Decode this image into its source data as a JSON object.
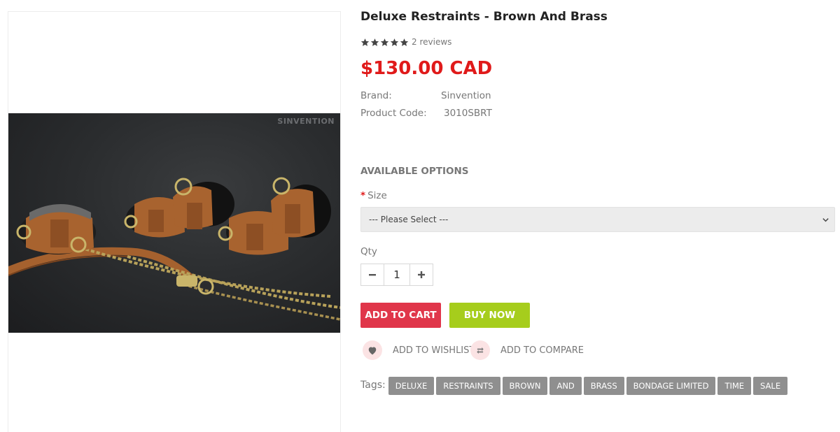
{
  "product": {
    "image_watermark": "SINVENTION",
    "title": "Deluxe Restraints - Brown And Brass",
    "rating_stars": 5,
    "reviews_text": "2 reviews",
    "price": "$130.00 CAD",
    "brand_label": "Brand:",
    "brand_value": "Sinvention",
    "code_label": "Product Code:",
    "code_value": "3010SBRT"
  },
  "options": {
    "title": "AVAILABLE OPTIONS",
    "required_mark": "*",
    "size_label": "Size",
    "size_selected": "--- Please Select ---"
  },
  "quantity": {
    "label": "Qty",
    "value": "1",
    "minus_icon": "minus-icon",
    "plus_icon": "plus-icon"
  },
  "buttons": {
    "add_to_cart": "ADD TO CART",
    "buy_now": "BUY NOW",
    "add_to_cart_color": "#e0364a",
    "buy_now_color": "#a6cd1c"
  },
  "actions": {
    "wishlist": "ADD TO WISHLIST",
    "compare": "ADD TO COMPARE"
  },
  "tags": {
    "label": "Tags:",
    "items": [
      "DELUXE",
      "RESTRAINTS",
      "BROWN",
      "AND",
      "BRASS",
      "BONDAGE LIMITED",
      "TIME",
      "SALE"
    ]
  },
  "colors": {
    "price": "#e01a1a",
    "tag_bg": "#8f8f8f"
  }
}
